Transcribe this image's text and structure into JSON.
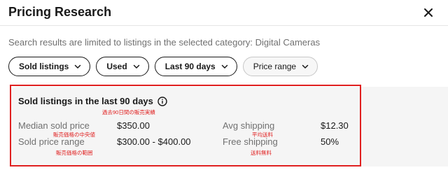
{
  "dialog": {
    "title": "Pricing Research",
    "close_icon": "close-icon"
  },
  "notice": "Search results are limited to listings in the selected category: Digital Cameras",
  "filters": [
    {
      "label": "Sold listings",
      "icon": "chevron-down-icon"
    },
    {
      "label": "Used",
      "icon": "chevron-down-icon"
    },
    {
      "label": "Last 90 days",
      "icon": "chevron-down-icon"
    },
    {
      "label": "Price range",
      "icon": "chevron-down-icon"
    }
  ],
  "summary": {
    "title": "Sold listings in the last 90 days",
    "title_note": "過去90日間の販売実績",
    "info_icon": "info-icon",
    "median_label": "Median sold price",
    "median_value": "$350.00",
    "median_note": "販売価格の中央値",
    "range_label": "Sold price range",
    "range_value": "$300.00 - $400.00",
    "range_note": "販売価格の範囲",
    "avg_shipping_label": "Avg shipping",
    "avg_shipping_value": "$12.30",
    "avg_shipping_note": "平均送料",
    "free_shipping_label": "Free shipping",
    "free_shipping_value": "50%",
    "free_shipping_note": "送料無料"
  },
  "colors": {
    "annotation": "#e02020",
    "text_primary": "#191919",
    "text_secondary": "#707070",
    "card_background": "#f5f5f5"
  }
}
